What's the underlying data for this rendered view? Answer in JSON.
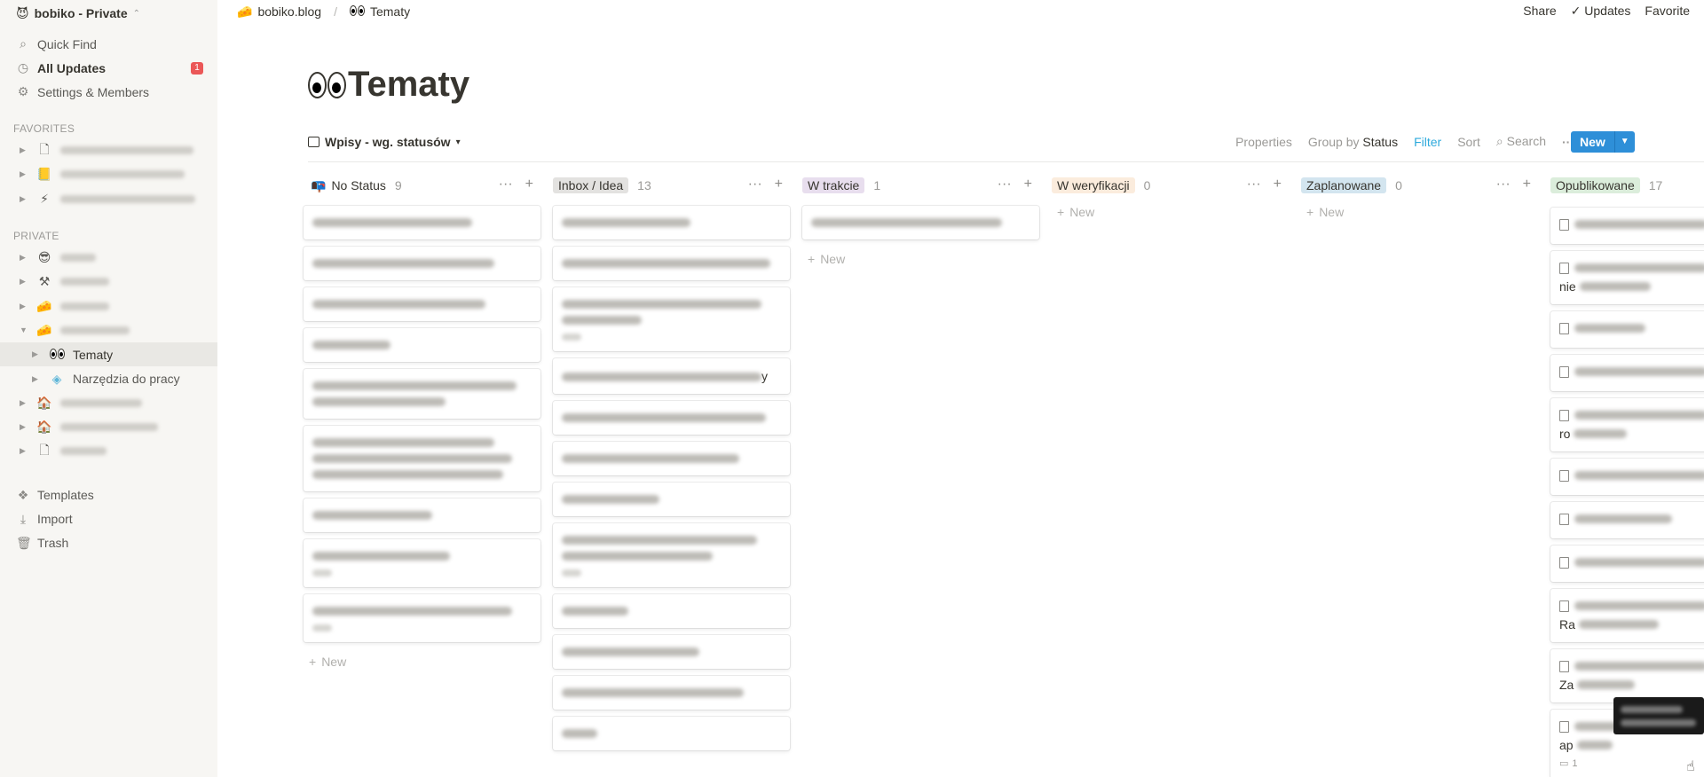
{
  "sidebar": {
    "workspace": "bobiko - Private",
    "nav": [
      {
        "label": "Quick Find",
        "icon": "search-icon"
      },
      {
        "label": "All Updates",
        "icon": "clock-icon",
        "badge": "1"
      },
      {
        "label": "Settings & Members",
        "icon": "gear-icon"
      }
    ],
    "favorites_label": "FAVORITES",
    "private_label": "PRIVATE",
    "current_page": "Tematy",
    "narzedzia": "Narzędzia do pracy",
    "bottom": [
      {
        "label": "Templates",
        "icon": "templates-icon"
      },
      {
        "label": "Import",
        "icon": "import-icon"
      },
      {
        "label": "Trash",
        "icon": "trash-icon"
      }
    ]
  },
  "topbar": {
    "crumb_parent": "bobiko.blog",
    "crumb_current": "Tematy",
    "share": "Share",
    "updates": "Updates",
    "favorite": "Favorite"
  },
  "page": {
    "title": "Tematy"
  },
  "view": {
    "name": "Wpisy - wg. statusów",
    "properties": "Properties",
    "group_by_label": "Group by",
    "group_by_value": "Status",
    "filter": "Filter",
    "sort": "Sort",
    "search": "Search",
    "new": "New"
  },
  "board": {
    "new_label": "New",
    "columns": [
      {
        "name": "No Status",
        "count": "9"
      },
      {
        "name": "Inbox / Idea",
        "count": "13"
      },
      {
        "name": "W trakcie",
        "count": "1"
      },
      {
        "name": "W weryfikacji",
        "count": "0"
      },
      {
        "name": "Zaplanowane",
        "count": "0"
      },
      {
        "name": "Opublikowane",
        "count": "17"
      }
    ],
    "visible_fragments": {
      "inbox_card4_tail": "y",
      "pub_card2": "nie",
      "pub_card5": "ro",
      "pub_card9": "Ra",
      "pub_card10": "Za",
      "pub_card11": "ap",
      "pub_card11_comments": "1"
    }
  },
  "colors": {
    "inbox_tag": "#e3e2e0",
    "w_trakcie_tag": "#e8deee",
    "w_weryfikacji_tag": "#fbecdd",
    "zaplanowane_tag": "#d3e5ef",
    "opublikowane_tag": "#dbeddb",
    "accent_blue": "#2e8fd8",
    "badge_red": "#eb5757"
  }
}
